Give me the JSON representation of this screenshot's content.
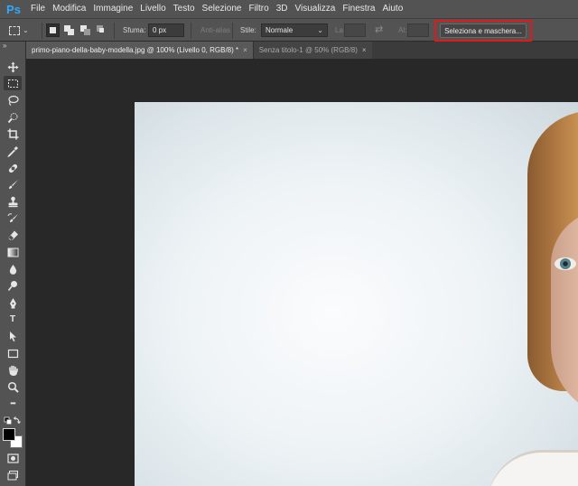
{
  "app": {
    "logo": "Ps"
  },
  "menu": [
    "File",
    "Modifica",
    "Immagine",
    "Livello",
    "Testo",
    "Selezione",
    "Filtro",
    "3D",
    "Visualizza",
    "Finestra",
    "Aiuto"
  ],
  "options": {
    "feather_label": "Sfuma:",
    "feather_value": "0 px",
    "antialias_label": "Anti-alias",
    "style_label": "Stile:",
    "style_value": "Normale",
    "width_label": "La:",
    "height_label": "Al:",
    "select_mask_label": "Seleziona e maschera..."
  },
  "tabs": [
    {
      "label": "primo-piano-della-baby-modella.jpg @ 100% (Livello 0, RGB/8) *",
      "close": "×",
      "active": true
    },
    {
      "label": "Senza titolo-1 @ 50% (RGB/8)",
      "close": "×",
      "active": false
    }
  ],
  "toolbar": {
    "collapse": "»",
    "type_tool_glyph": "T",
    "more_glyph": "•••"
  },
  "colors": {
    "foreground": "#000000",
    "background": "#ffffff",
    "highlight": "#e0191b",
    "brand": "#31a8ff"
  }
}
